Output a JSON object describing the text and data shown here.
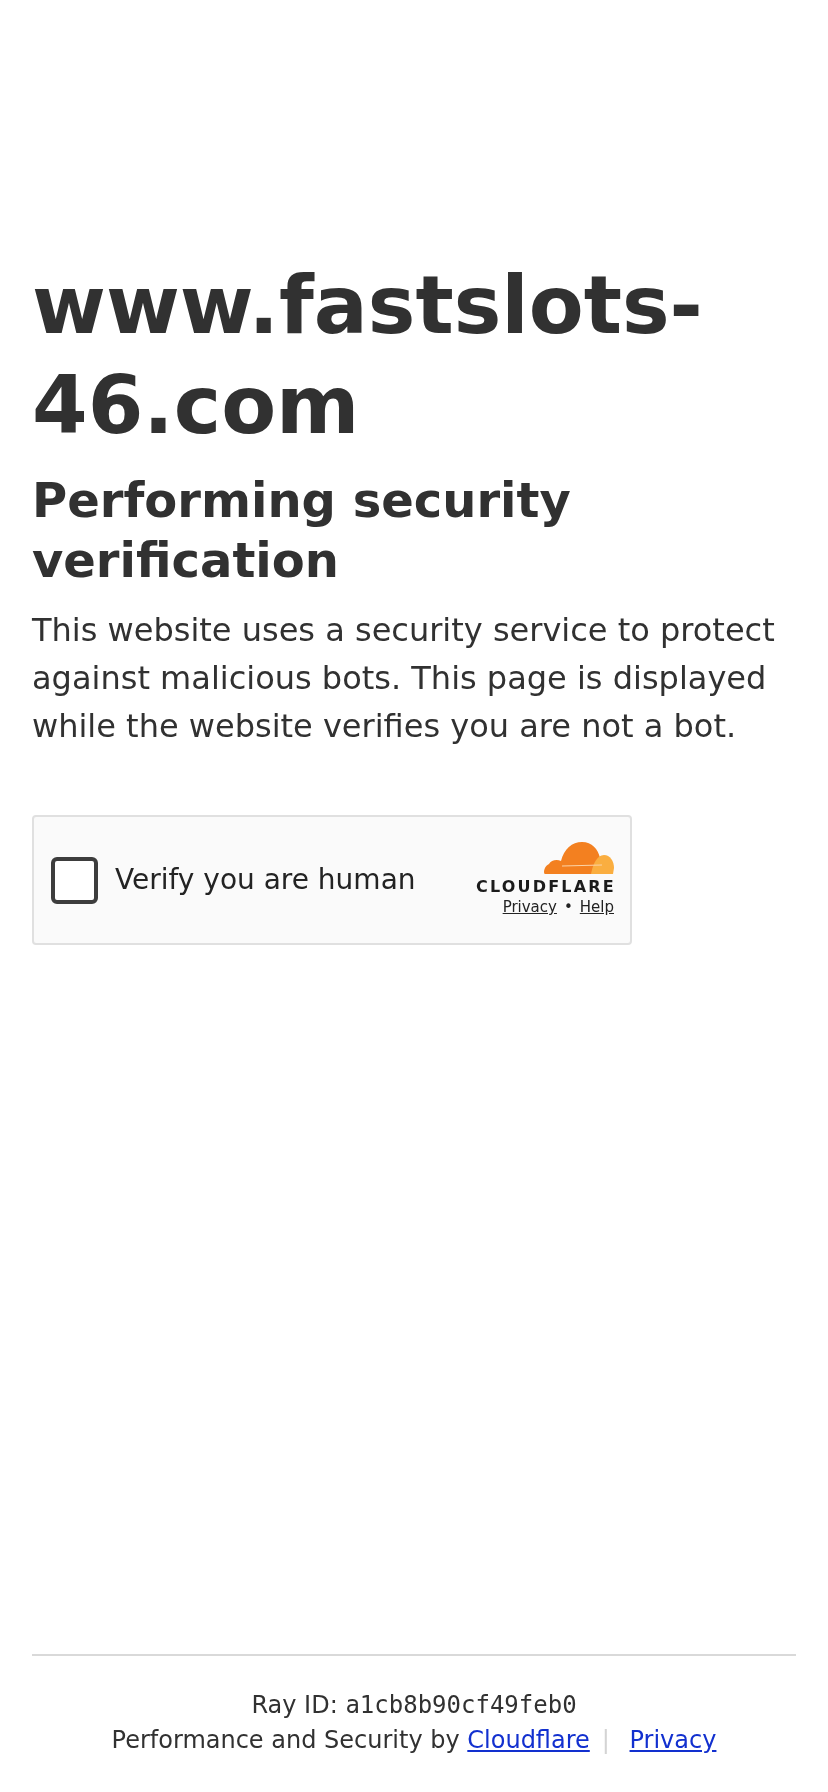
{
  "heading": "www.fastslots-46.com",
  "subheading": "Performing security verification",
  "description": "This website uses a security service to protect against malicious bots. This page is displayed while the website verifies you are not a bot.",
  "challenge": {
    "checked": false,
    "label": "Verify you are human",
    "brand": "CLOUDFLARE",
    "links": [
      "Privacy",
      "Help"
    ],
    "link_separator": "•"
  },
  "footer": {
    "ray_id_label": "Ray ID:",
    "ray_id": "a1cb8b90cf49feb0",
    "credit": "Performance and Security by",
    "links": [
      "Cloudflare",
      "Privacy"
    ],
    "separator": "|"
  }
}
